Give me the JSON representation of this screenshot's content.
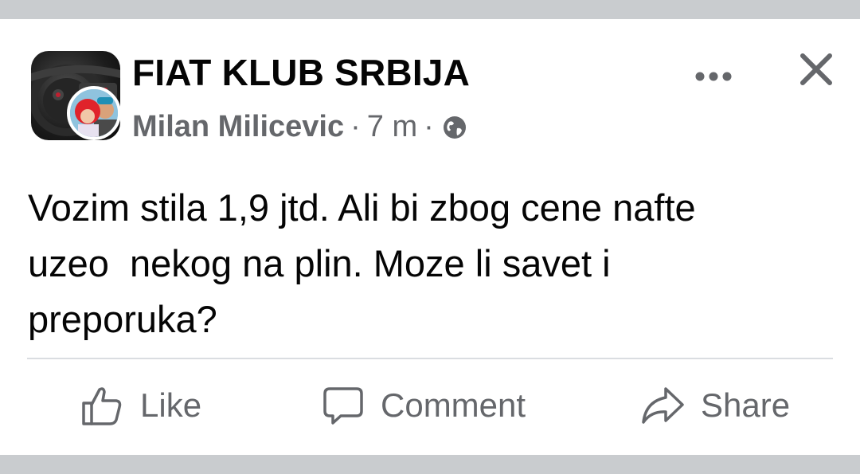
{
  "post": {
    "group_name": "FIAT KLUB SRBIJA",
    "author": "Milan Milicevic",
    "separator": "·",
    "time": "7 m",
    "privacy_icon": "globe-icon",
    "body": "Vozim stila 1,9 jtd. Ali bi zbog cene nafte\nuzeo  nekog na plin. Moze li savet i\npreporuka?"
  },
  "header_actions": {
    "more_icon": "more-horizontal-icon",
    "close_icon": "close-icon"
  },
  "actions": [
    {
      "label": "Like",
      "icon": "thumbs-up-icon"
    },
    {
      "label": "Comment",
      "icon": "comment-bubble-icon"
    },
    {
      "label": "Share",
      "icon": "share-arrow-icon"
    }
  ],
  "colors": {
    "text_primary": "#050505",
    "text_secondary": "#65676b",
    "divider": "#dadde1",
    "band": "#c9cccf"
  }
}
